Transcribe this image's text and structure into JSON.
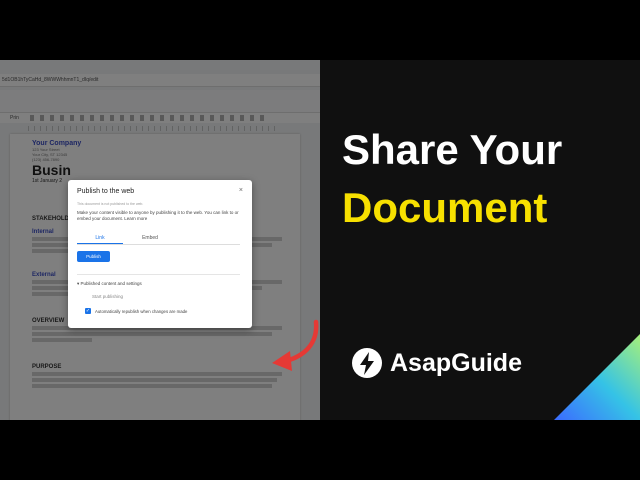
{
  "browser": {
    "url": "5d1OB1hTyCaHd_8WWWhhmnT1_dIq/edit"
  },
  "toolbar": {
    "zoom": "Prin"
  },
  "document": {
    "company": "Your Company",
    "address_lines": [
      "123 Your Street",
      "Your City, ST 12345",
      "(123) 456-7890"
    ],
    "title": "Busin",
    "date": "1st January 2",
    "sections": {
      "stakeholders": "STAKEHOLD",
      "internal": "Internal",
      "external": "External",
      "overview": "OVERVIEW",
      "purpose": "PURPOSE"
    }
  },
  "dialog": {
    "title": "Publish to the web",
    "close": "×",
    "subtitle": "This document is not published to the web.",
    "description": "Make your content visible to anyone by publishing it to the web. You can link to or embed your document. Learn more",
    "tabs": [
      {
        "label": "Link"
      },
      {
        "label": "Embed"
      }
    ],
    "publish_button": "Publish",
    "published_controls": "Published content and settings",
    "start_publishing": "Start publishing",
    "auto_republish": "Automatically republish when changes are made"
  },
  "headline": {
    "line1": "Share Your",
    "line2": "Document"
  },
  "brand": {
    "name": "AsapGuide"
  },
  "colors": {
    "headline_accent": "#f7e000",
    "arrow": "#e53935",
    "link_blue": "#1a73e8"
  }
}
